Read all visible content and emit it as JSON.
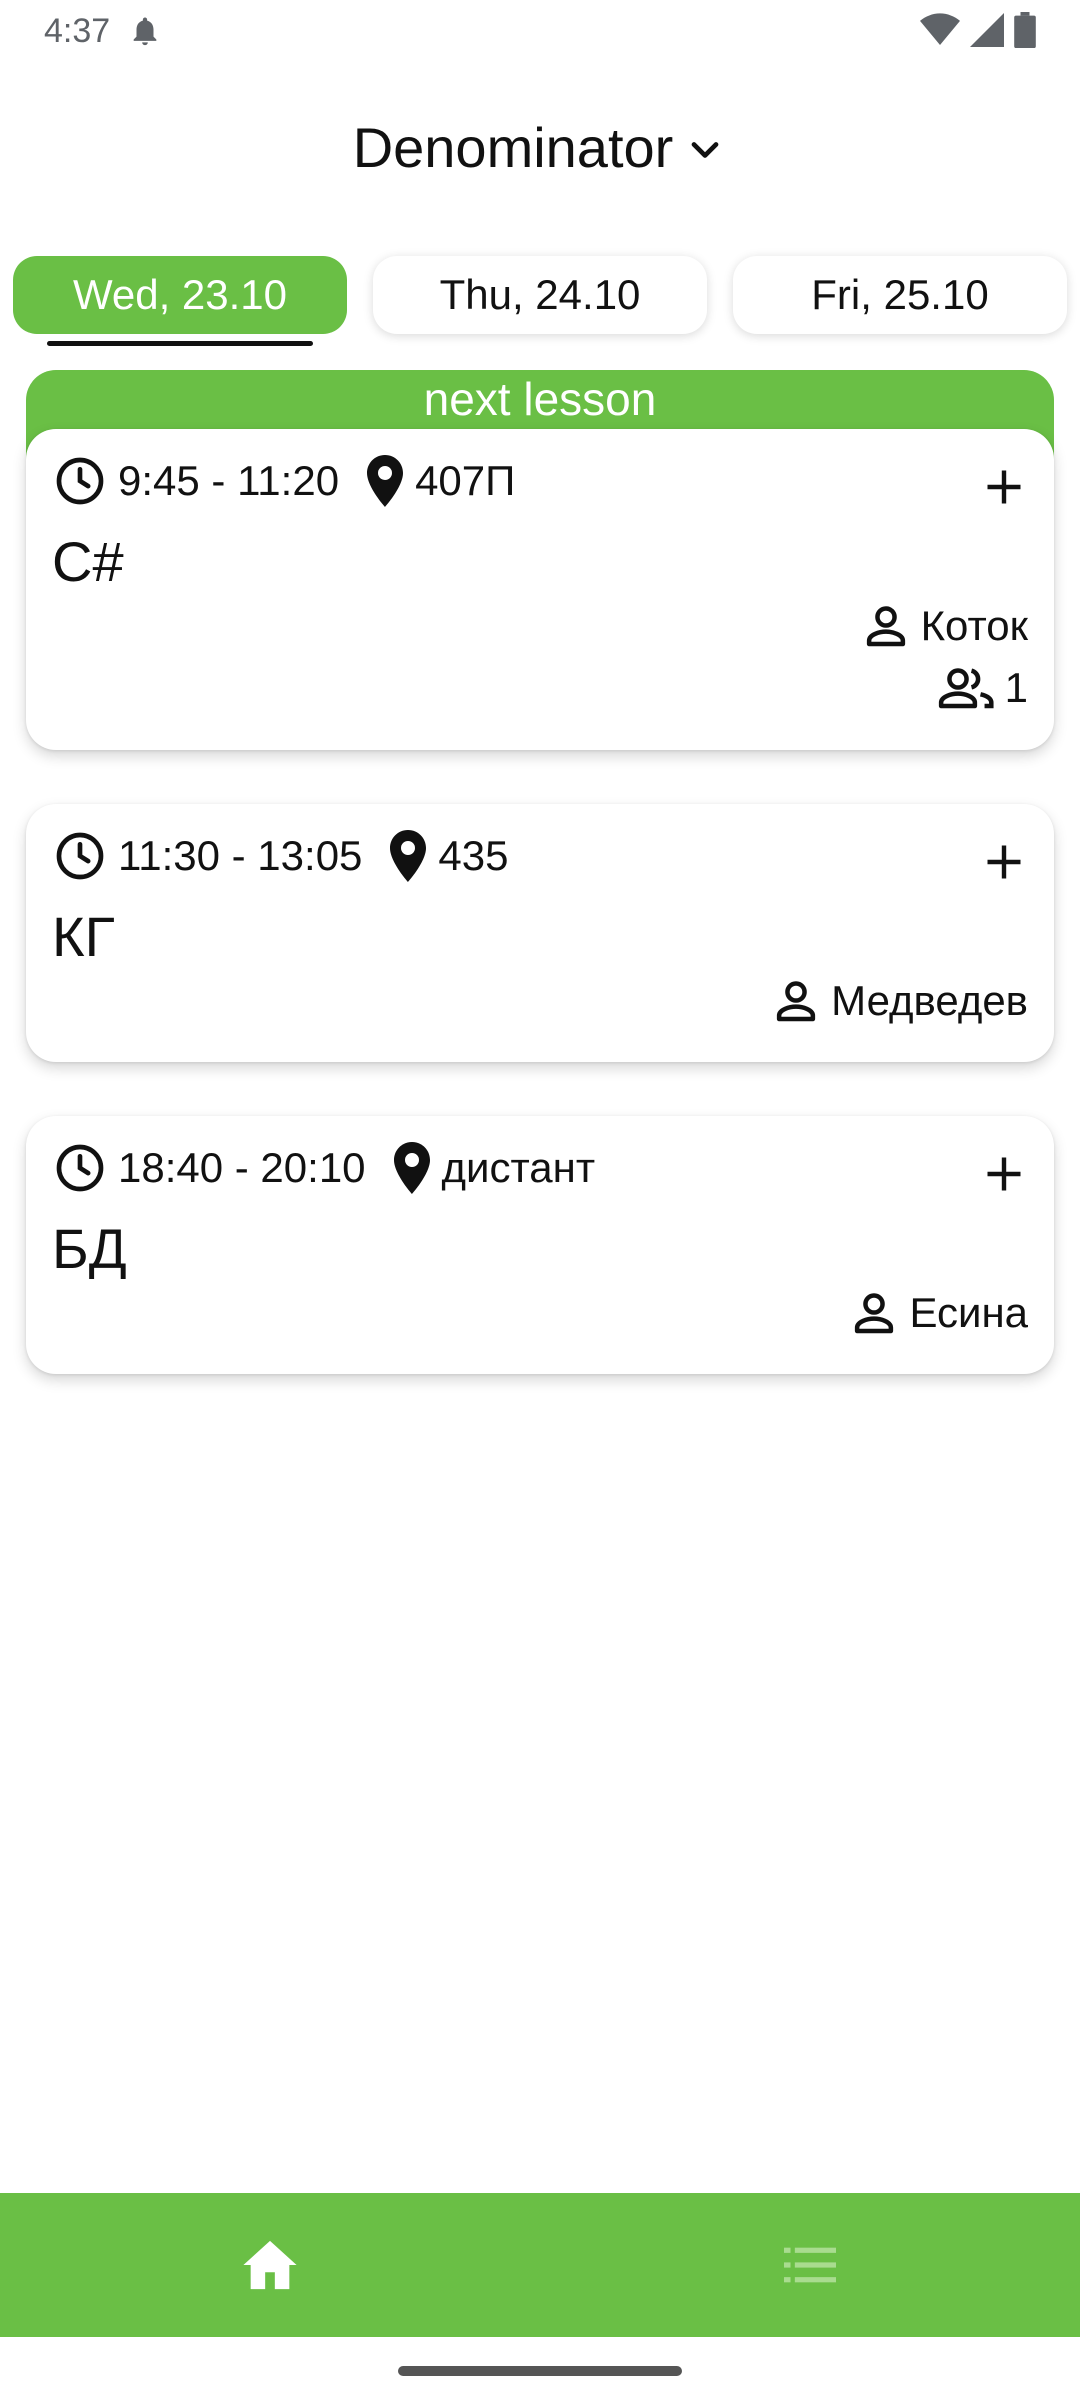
{
  "status_bar": {
    "time": "4:37",
    "icons": [
      "notification-bell-icon",
      "wifi-icon",
      "signal-icon",
      "battery-icon"
    ]
  },
  "header": {
    "title": "Denominator",
    "dropdown_icon": "chevron-down-icon"
  },
  "day_tabs": [
    {
      "label": "Wed, 23.10",
      "active": true
    },
    {
      "label": "Thu, 24.10",
      "active": false
    },
    {
      "label": "Fri, 25.10",
      "active": false
    }
  ],
  "next_lesson_label": "next lesson",
  "lessons": [
    {
      "time": "9:45 - 11:20",
      "room": "407П",
      "subject": "C#",
      "teacher": "Коток",
      "group": "1"
    },
    {
      "time": "11:30 - 13:05",
      "room": "435",
      "subject": "КГ",
      "teacher": "Медведев"
    },
    {
      "time": "18:40 - 20:10",
      "room": "дистант",
      "subject": "БД",
      "teacher": "Есина"
    }
  ],
  "bottom_nav": [
    {
      "icon": "home-icon",
      "active": true
    },
    {
      "icon": "list-icon",
      "active": false
    }
  ],
  "colors": {
    "accent": "#6abf45",
    "text": "#111111",
    "inactive_nav_icon": "#a9dc8f"
  }
}
